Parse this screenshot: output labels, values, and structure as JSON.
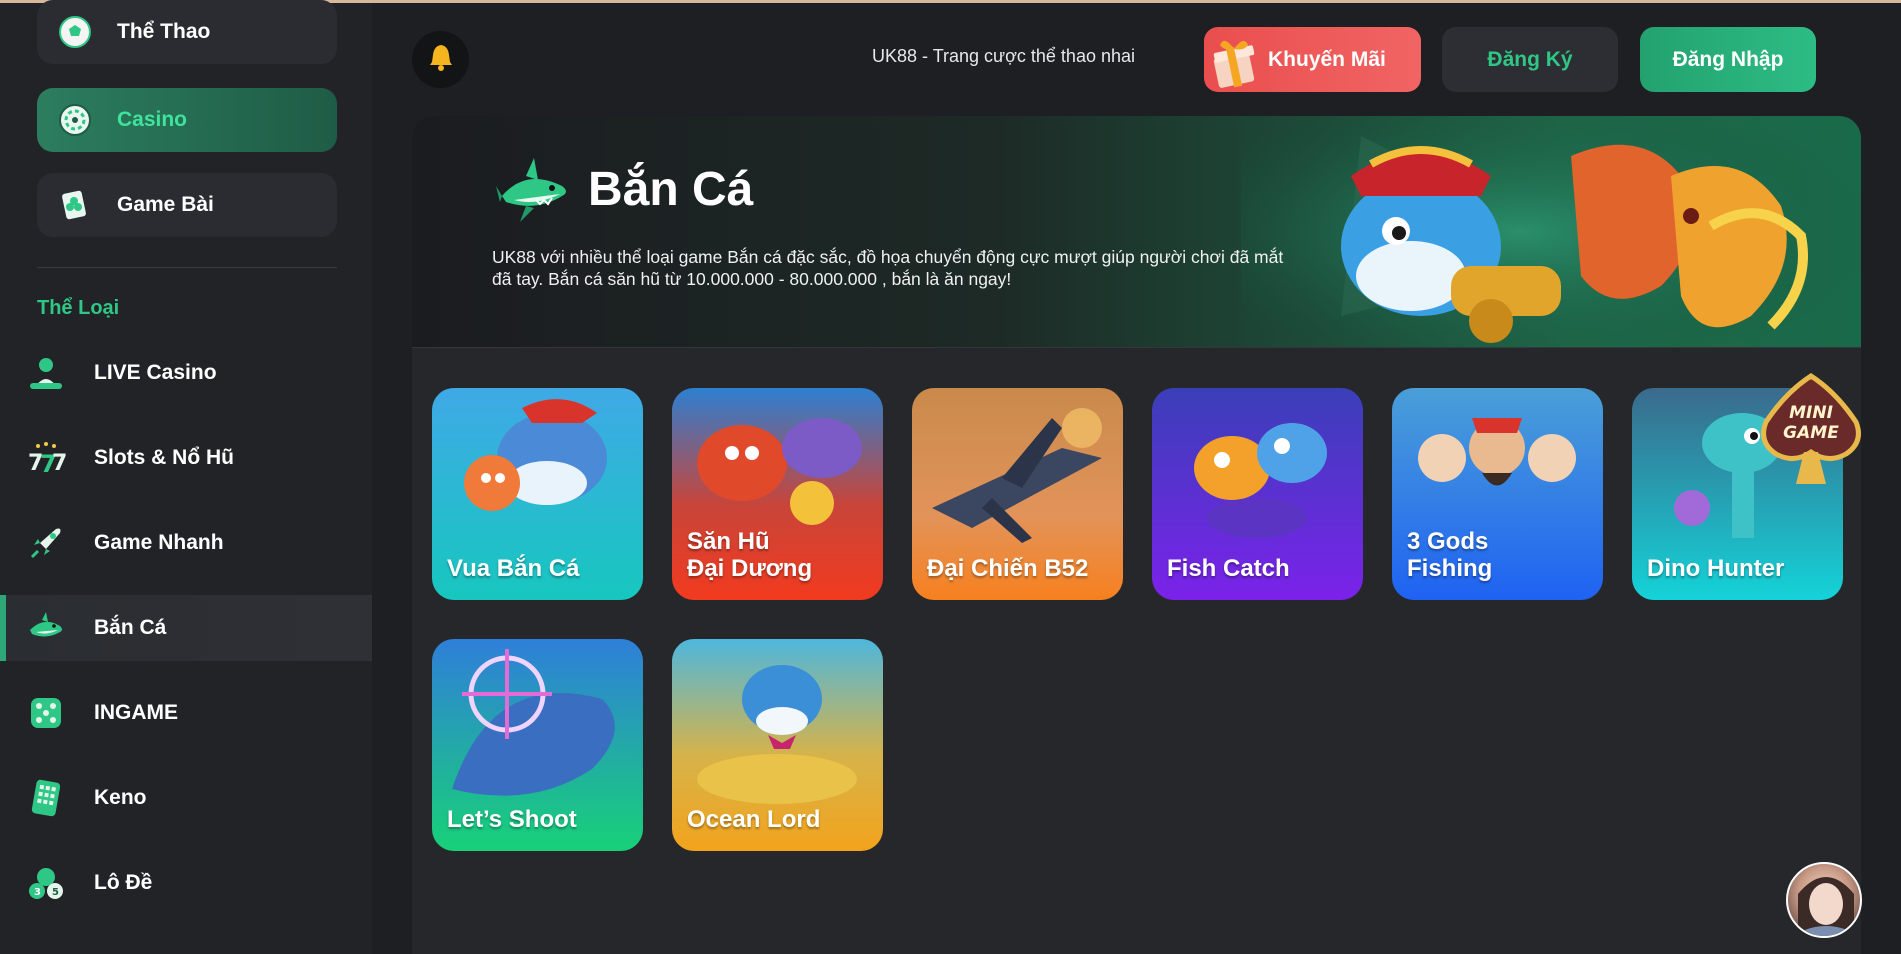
{
  "sidebar": {
    "top_items": [
      {
        "label": "Thể Thao",
        "icon": "soccer-ball-icon"
      },
      {
        "label": "Casino",
        "icon": "roulette-wheel-icon",
        "active": true
      },
      {
        "label": "Game Bài",
        "icon": "card-club-icon"
      }
    ],
    "section_title": "Thể Loại",
    "categories": [
      {
        "label": "LIVE Casino",
        "icon": "live-dealer-icon"
      },
      {
        "label": "Slots & Nổ Hũ",
        "icon": "slot-777-icon"
      },
      {
        "label": "Game Nhanh",
        "icon": "rocket-icon"
      },
      {
        "label": "Bắn Cá",
        "icon": "shark-icon",
        "active": true
      },
      {
        "label": "INGAME",
        "icon": "dice-icon"
      },
      {
        "label": "Keno",
        "icon": "keno-board-icon"
      },
      {
        "label": "Lô Đề",
        "icon": "lottery-balls-icon"
      }
    ]
  },
  "header": {
    "marquee": "UK88 - Trang cược thể thao nhai",
    "promo_label": "Khuyến Mãi",
    "register_label": "Đăng Ký",
    "login_label": "Đăng Nhập"
  },
  "banner": {
    "title": "Bắn Cá",
    "description": "UK88 với nhiều thể loại game Bắn cá đặc sắc, đồ họa chuyển động cực mượt giúp người chơi đã mắt đã tay. Bắn cá săn hũ từ 10.000.000 - 80.000.000 , bắn là ăn ngay!"
  },
  "games": [
    {
      "name": "Vua Bắn Cá",
      "color_top": "#3fa9e6",
      "color_bottom": "#17c7bf"
    },
    {
      "name": "Săn Hũ\nĐại Dương",
      "color_top": "#2d7fd1",
      "color_bottom": "#f23a1f"
    },
    {
      "name": "Đại Chiến B52",
      "color_top": "#c98a4b",
      "color_bottom": "#f7801f"
    },
    {
      "name": "Fish Catch",
      "color_top": "#3a3fb8",
      "color_bottom": "#7b22ea"
    },
    {
      "name": "3 Gods\nFishing",
      "color_top": "#4a9fd8",
      "color_bottom": "#1f62f2"
    },
    {
      "name": "Dino Hunter",
      "color_top": "#3a6a8c",
      "color_bottom": "#14d3d8"
    },
    {
      "name": "Let’s Shoot",
      "color_top": "#2f7fd9",
      "color_bottom": "#17d178"
    },
    {
      "name": "Ocean Lord",
      "color_top": "#4eb7dd",
      "color_bottom": "#f3a31c"
    }
  ],
  "minigame_label": "MINI GAME"
}
